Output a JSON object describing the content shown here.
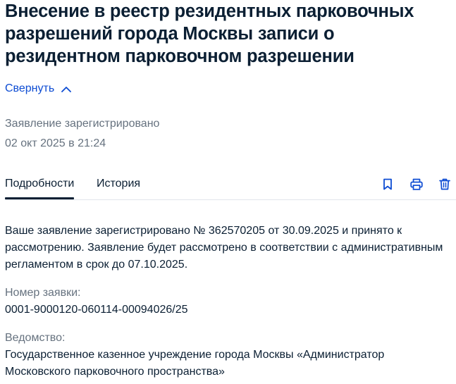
{
  "header": {
    "title": "Внесение в реестр резидентных парковочных разрешений города Москвы записи о резидентном парковочном разрешении",
    "collapse_label": "Свернуть"
  },
  "status": {
    "label": "Заявление зарегистрировано",
    "date": "02 окт 2025 в 21:24"
  },
  "tabs": [
    {
      "label": "Подробности",
      "active": true
    },
    {
      "label": "История",
      "active": false
    }
  ],
  "toolbar": {
    "icons": [
      "bookmark-icon",
      "print-icon",
      "trash-icon"
    ],
    "icon_color": "#0d4cd3"
  },
  "details": {
    "message": "Ваше заявление зарегистрировано № 362570205 от 30.09.2025 и принято к рассмотрению. Заявление будет рассмотрено в соответствии с административным регламентом в срок до 07.10.2025.",
    "fields": [
      {
        "label": "Номер заявки:",
        "value": "0001-9000120-060114-00094026/25"
      },
      {
        "label": "Ведомство:",
        "value": "Государственное казенное учреждение города Москвы «Администратор Московского парковочного пространства»"
      }
    ]
  },
  "colors": {
    "text": "#0b1f33",
    "muted": "#66727f",
    "link": "#0d4cd3",
    "divider": "#e1e5eb"
  }
}
